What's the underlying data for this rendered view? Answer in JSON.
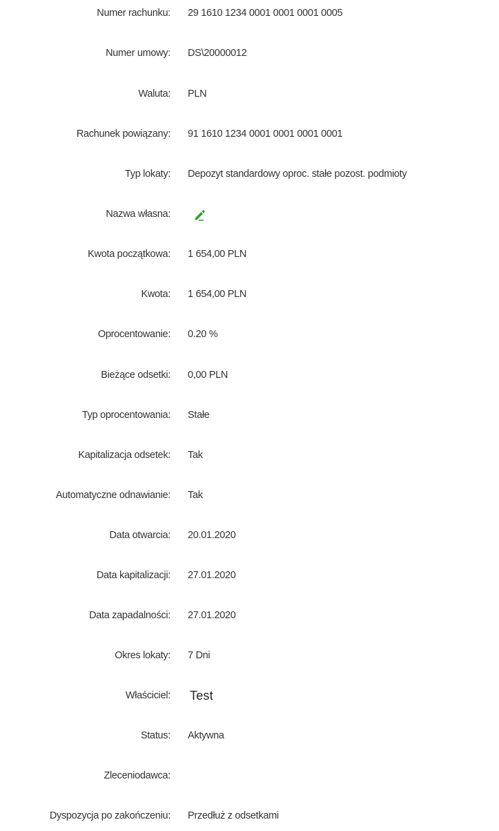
{
  "details": [
    {
      "label": "Numer rachunku:",
      "value": "29 1610 1234 0001 0001 0001 0005"
    },
    {
      "label": "Numer umowy:",
      "value": "DS\\20000012"
    },
    {
      "label": "Waluta:",
      "value": "PLN"
    },
    {
      "label": "Rachunek powiązany:",
      "value": "91 1610 1234 0001 0001 0001 0001"
    },
    {
      "label": "Typ lokaty:",
      "value": "Depozyt standardowy oproc. stałe pozost. podmioty"
    },
    {
      "label": "Nazwa własna:",
      "icon": "pencil-edit-icon",
      "icon_color": "#2e9e2e"
    },
    {
      "label": "Kwota początkowa:",
      "value": "1 654,00 PLN"
    },
    {
      "label": "Kwota:",
      "value": "1 654,00 PLN"
    },
    {
      "label": "Oprocentowanie:",
      "value": "0.20 %"
    },
    {
      "label": "Bieżące odsetki:",
      "value": "0,00 PLN"
    },
    {
      "label": "Typ oprocentowania:",
      "value": "Stałe"
    },
    {
      "label": "Kapitalizacja odsetek:",
      "value": "Tak"
    },
    {
      "label": "Automatyczne odnawianie:",
      "value": "Tak"
    },
    {
      "label": "Data otwarcia:",
      "value": "20.01.2020"
    },
    {
      "label": "Data kapitalizacji:",
      "value": "27.01.2020"
    },
    {
      "label": "Data zapadalności:",
      "value": "27.01.2020"
    },
    {
      "label": "Okres lokaty:",
      "value": "7 Dni"
    },
    {
      "label": "Właściciel:",
      "value": "Test"
    },
    {
      "label": "Status:",
      "value": "Aktywna"
    },
    {
      "label": "Zleceniodawca:",
      "value": ""
    },
    {
      "label": "Dyspozycja po zakończeniu:",
      "value": "Przedłuż z odsetkami"
    }
  ],
  "colors": {
    "text": "#333333",
    "edit_icon": "#2e9e2e"
  }
}
